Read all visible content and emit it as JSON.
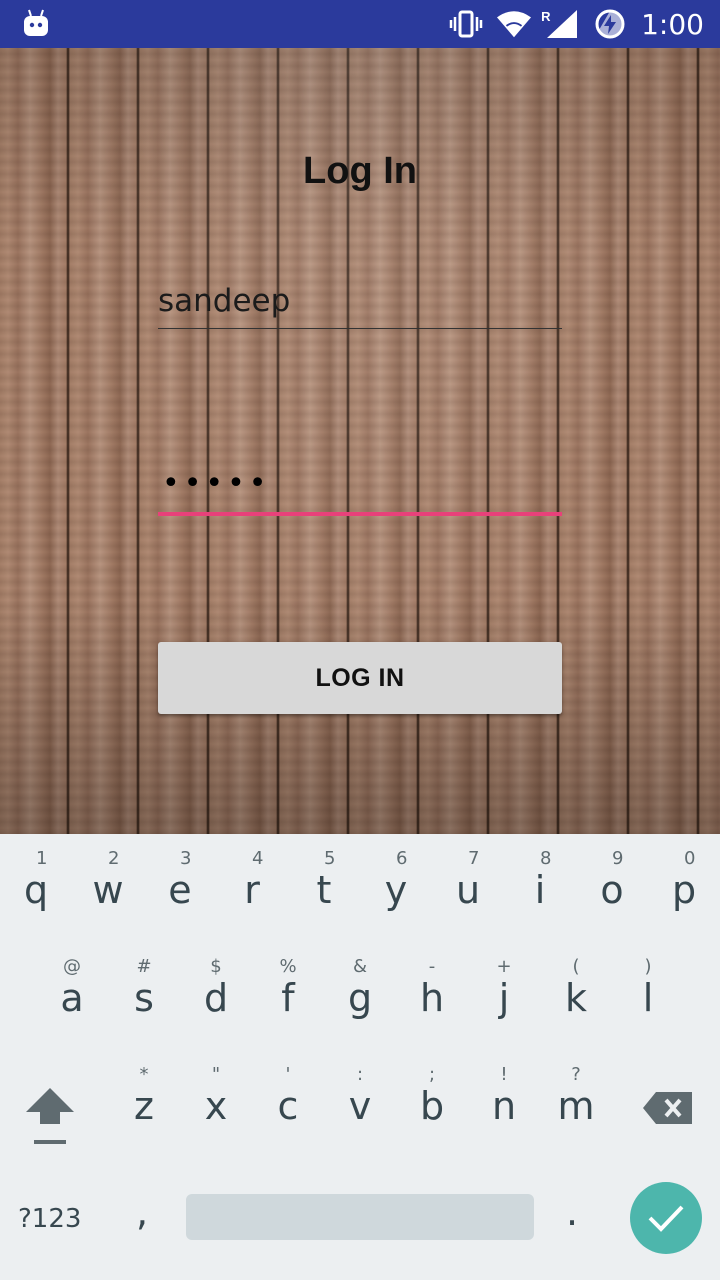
{
  "status_bar": {
    "time": "1:00",
    "icons": [
      "android-icon",
      "vibrate-icon",
      "wifi-icon",
      "signal-icon",
      "battery-charging-icon"
    ],
    "signal_label": "R"
  },
  "screen": {
    "title": "Log In",
    "username_value": "sandeep",
    "password_mask": "•••••",
    "login_button": "LOG IN",
    "colors": {
      "accent": "#e8417a",
      "status_bar": "#2b3a9c",
      "button_bg": "#d8d8d8"
    }
  },
  "keyboard": {
    "row1": [
      {
        "ch": "q",
        "hint": "1"
      },
      {
        "ch": "w",
        "hint": "2"
      },
      {
        "ch": "e",
        "hint": "3"
      },
      {
        "ch": "r",
        "hint": "4"
      },
      {
        "ch": "t",
        "hint": "5"
      },
      {
        "ch": "y",
        "hint": "6"
      },
      {
        "ch": "u",
        "hint": "7"
      },
      {
        "ch": "i",
        "hint": "8"
      },
      {
        "ch": "o",
        "hint": "9"
      },
      {
        "ch": "p",
        "hint": "0"
      }
    ],
    "row2": [
      {
        "ch": "a",
        "hint": "@"
      },
      {
        "ch": "s",
        "hint": "#"
      },
      {
        "ch": "d",
        "hint": "$"
      },
      {
        "ch": "f",
        "hint": "%"
      },
      {
        "ch": "g",
        "hint": "&"
      },
      {
        "ch": "h",
        "hint": "-"
      },
      {
        "ch": "j",
        "hint": "+"
      },
      {
        "ch": "k",
        "hint": "("
      },
      {
        "ch": "l",
        "hint": ")"
      }
    ],
    "row3": [
      {
        "ch": "z",
        "hint": "*"
      },
      {
        "ch": "x",
        "hint": "\""
      },
      {
        "ch": "c",
        "hint": "'"
      },
      {
        "ch": "v",
        "hint": ":"
      },
      {
        "ch": "b",
        "hint": ";"
      },
      {
        "ch": "n",
        "hint": "!"
      },
      {
        "ch": "m",
        "hint": "?"
      }
    ],
    "symbols_label": "?123",
    "comma_label": ",",
    "period_label": ".",
    "accent": "#4db6ac"
  }
}
